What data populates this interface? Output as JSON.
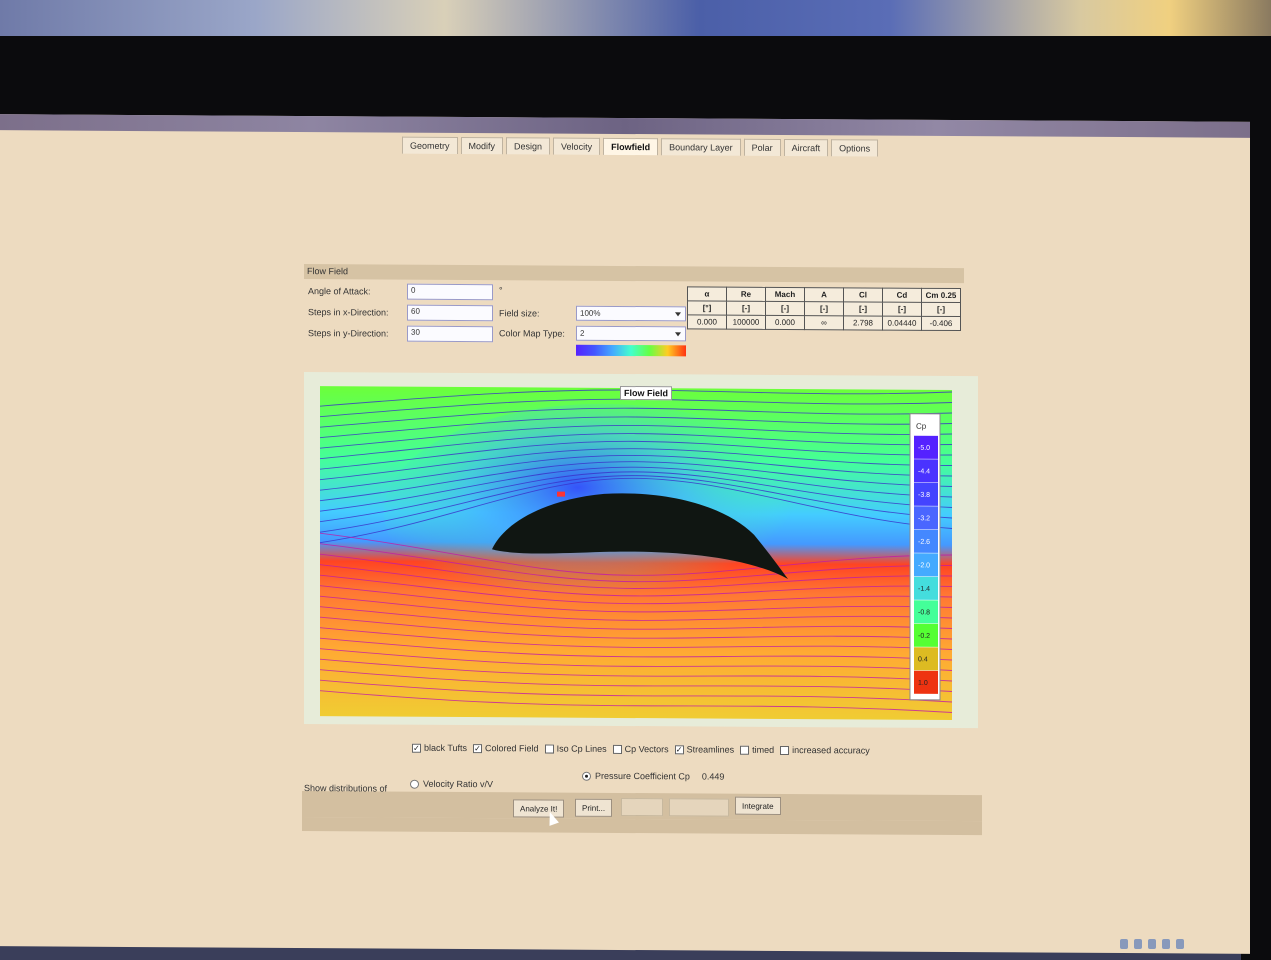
{
  "tabs": [
    {
      "label": "Geometry"
    },
    {
      "label": "Modify"
    },
    {
      "label": "Design"
    },
    {
      "label": "Velocity"
    },
    {
      "label": "Flowfield"
    },
    {
      "label": "Boundary Layer"
    },
    {
      "label": "Polar"
    },
    {
      "label": "Aircraft"
    },
    {
      "label": "Options"
    }
  ],
  "active_tab": "Flowfield",
  "panel": {
    "title": "Flow Field",
    "angle_label": "Angle of Attack:",
    "angle_value": "0",
    "angle_unit": "°",
    "steps_x_label": "Steps in x-Direction:",
    "steps_x_value": "60",
    "steps_y_label": "Steps in y-Direction:",
    "steps_y_value": "30",
    "field_size_label": "Field size:",
    "field_size_value": "100%",
    "color_map_label": "Color Map Type:",
    "color_map_value": "2"
  },
  "coefficients": {
    "headers": [
      "α",
      "Re",
      "Mach",
      "A",
      "Cl",
      "Cd",
      "Cm 0.25"
    ],
    "units": [
      "[°]",
      "[-]",
      "[-]",
      "[-]",
      "[-]",
      "[-]",
      "[-]"
    ],
    "values": [
      "0.000",
      "100000",
      "0.000",
      "∞",
      "2.798",
      "0.04440",
      "-0.406"
    ]
  },
  "plot": {
    "title": "Flow Field",
    "legend_title": "Cp",
    "legend_values": [
      "-5.0",
      "-4.4",
      "-3.8",
      "-3.2",
      "-2.6",
      "-2.0",
      "-1.4",
      "-0.8",
      "-0.2",
      "0.4",
      "1.0"
    ],
    "legend_colors": [
      "#5522ff",
      "#4a33ff",
      "#4444ff",
      "#4a66ff",
      "#4488ff",
      "#44aaff",
      "#44dddd",
      "#44ff99",
      "#55ff33",
      "#ddbb22",
      "#ee3311"
    ]
  },
  "options": [
    {
      "label": "black Tufts",
      "checked": true
    },
    {
      "label": "Colored Field",
      "checked": true
    },
    {
      "label": "Iso Cp Lines",
      "checked": false
    },
    {
      "label": "Cp Vectors",
      "checked": false
    },
    {
      "label": "Streamlines",
      "checked": true
    },
    {
      "label": "timed",
      "checked": false
    },
    {
      "label": "increased accuracy",
      "checked": false
    }
  ],
  "distributions": {
    "label": "Show distributions of",
    "velocity_option": "Velocity Ratio v/V",
    "pressure_option": "Pressure Coefficient Cp",
    "pressure_value": "0.449"
  },
  "buttons": {
    "analyze": "Analyze It!",
    "print": "Print...",
    "integrate": "Integrate"
  }
}
